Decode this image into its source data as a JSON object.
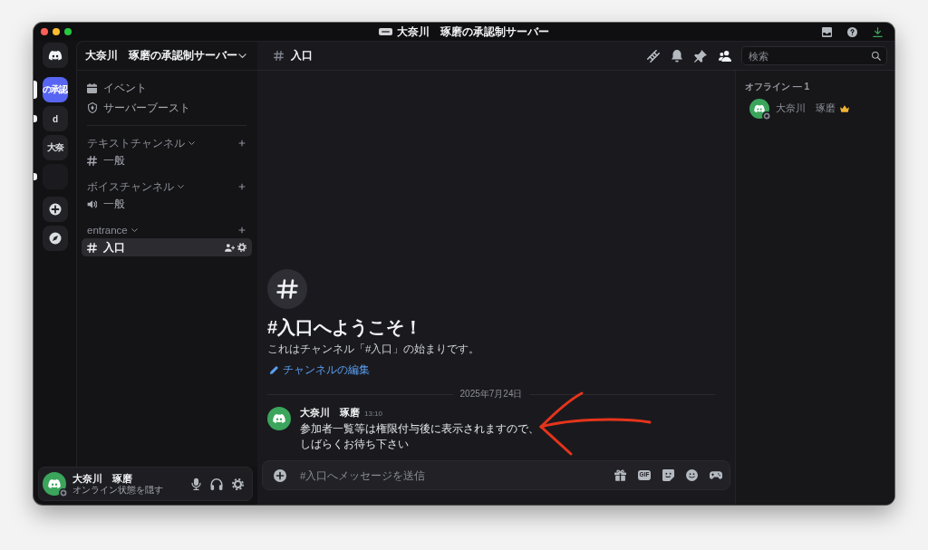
{
  "window": {
    "title": "大奈川　琢磨の承認制サーバー"
  },
  "servers": [
    {
      "kind": "text",
      "label": "の承認",
      "selected": true,
      "unread": false
    },
    {
      "kind": "text",
      "label": "d",
      "selected": false,
      "unread": true
    },
    {
      "kind": "text",
      "label": "大奈",
      "selected": false,
      "unread": false
    },
    {
      "kind": "image",
      "selected": false,
      "unread": true
    }
  ],
  "sidebar": {
    "title": "大奈川　琢磨の承認制サーバー",
    "shortcuts": [
      {
        "kind": "events",
        "label": "イベント"
      },
      {
        "kind": "boost",
        "label": "サーバーブースト"
      }
    ],
    "categories": [
      {
        "name": "テキストチャンネル",
        "expanded": true,
        "channels": [
          {
            "kind": "text",
            "name": "一般",
            "selected": false
          }
        ]
      },
      {
        "name": "ボイスチャンネル",
        "expanded": true,
        "channels": [
          {
            "kind": "voice",
            "name": "一般",
            "selected": false
          }
        ]
      },
      {
        "name": "entrance",
        "expanded": true,
        "channels": [
          {
            "kind": "text",
            "name": "入口",
            "selected": true
          }
        ]
      }
    ]
  },
  "user_panel": {
    "name": "大奈川　琢磨",
    "status_text": "オンライン状態を隠す",
    "offline": true
  },
  "header": {
    "channel": "入口",
    "search": {
      "placeholder": "検索"
    }
  },
  "welcome": {
    "title": "#入口へようこそ！",
    "subtitle": "これはチャンネル「#入口」の始まりです。",
    "edit_link": "チャンネルの編集"
  },
  "date_divider": "2025年7月24日",
  "messages": [
    {
      "author": "大奈川　琢磨",
      "time": "13:10",
      "lines": [
        "参加者一覧等は権限付与後に表示されますので、",
        "しばらくお待ち下さい"
      ]
    }
  ],
  "composer": {
    "placeholder": "#入口へメッセージを送信",
    "gif_label": "GIF"
  },
  "members": {
    "groups": [
      {
        "title": "オフライン — 1",
        "members": [
          {
            "name": "大奈川　琢磨",
            "offline": true,
            "owner": true
          }
        ]
      }
    ]
  },
  "annotations": [
    {
      "kind": "arrow"
    }
  ]
}
